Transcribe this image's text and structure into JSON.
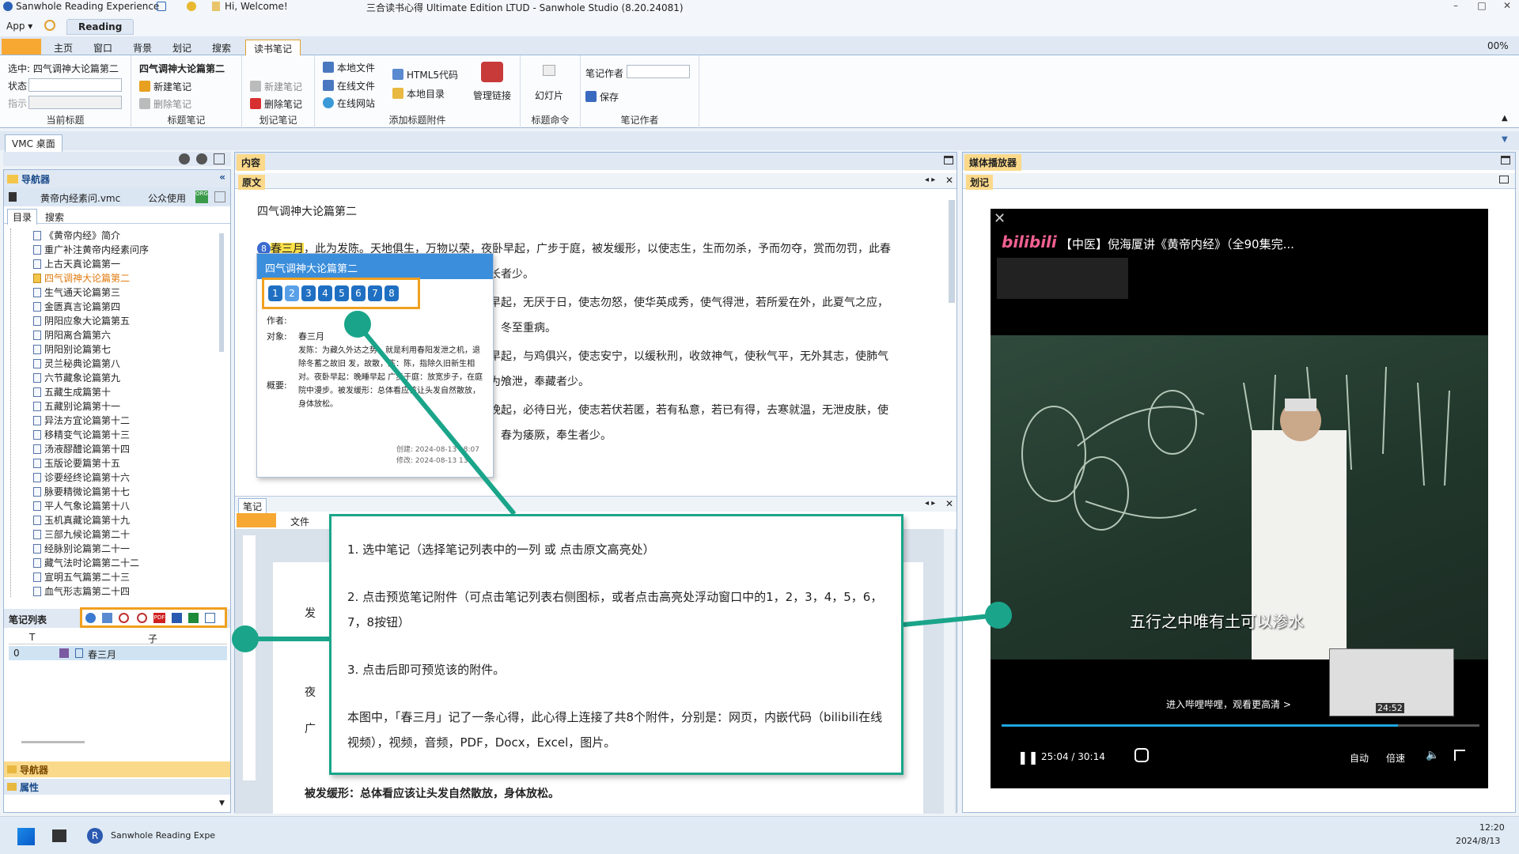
{
  "titlebar": {
    "app_name": "Sanwhole Reading Experience",
    "greeting": "Hi, Welcome!",
    "window_title": "三合读书心得 Ultimate Edition LTUD - Sanwhole Studio (8.20.24081)"
  },
  "menu": {
    "app": "App",
    "reading_tab": "Reading",
    "zoom": "00%"
  },
  "ribbon_tabs": [
    "主页",
    "窗口",
    "背景",
    "划记",
    "搜索",
    "读书笔记"
  ],
  "ribbon": {
    "selected_label": "选中: 四气调神大论篇第二",
    "status_label": "状态",
    "pointer_label": "指示",
    "group1": "当前标题",
    "title_name": "四气调神大论篇第二",
    "new_note": "新建笔记",
    "delete_note": "删除笔记",
    "group2": "标题笔记",
    "new_note2": "新建笔记",
    "delete_note2": "删除笔记",
    "group3": "划记笔记",
    "local_file": "本地文件",
    "online_file": "在线文件",
    "online_site": "在线网站",
    "html5": "HTML5代码",
    "local_dir": "本地目录",
    "group4": "添加标题附件",
    "manage_link": "管理链接",
    "slides": "幻灯片",
    "group5": "标题命令",
    "note_author": "笔记作者",
    "save": "保存",
    "group6": "笔记作者"
  },
  "vmc_tab": "VMC 桌面",
  "navigator": {
    "title": "导航器",
    "file": "黄帝内经素问.vmc",
    "public_use": "公众使用",
    "tabs": [
      "目录",
      "搜索"
    ],
    "tree": [
      "《黄帝内经》简介",
      "重广补注黄帝内经素问序",
      "上古天真论篇第一",
      "四气调神大论篇第二",
      "生气通天论篇第三",
      "金匮真言论篇第四",
      "阴阳应象大论篇第五",
      "阴阳离合篇第六",
      "阴阳别论篇第七",
      "灵兰秘典论篇第八",
      "六节藏象论篇第九",
      "五藏生成篇第十",
      "五藏别论篇第十一",
      "异法方宜论篇第十二",
      "移精变气论篇第十三",
      "汤液醪醴论篇第十四",
      "玉版论要篇第十五",
      "诊要经终论篇第十六",
      "脉要精微论篇第十七",
      "平人气象论篇第十八",
      "玉机真藏论篇第十九",
      "三部九候论篇第二十",
      "经脉别论篇第二十一",
      "藏气法时论篇第二十二",
      "宣明五气篇第二十三",
      "血气形志篇第二十四"
    ],
    "selected_index": 3,
    "note_list_title": "笔记列表",
    "col_t": "T",
    "col_title": "子",
    "row_index": "0",
    "row_title": "春三月",
    "bottom1": "导航器",
    "bottom2": "属性"
  },
  "content": {
    "panel_title": "内容",
    "tab_original": "原文",
    "heading": "四气调神大论篇第二",
    "badge": "8",
    "highlight": "春三月",
    "line1": "，此为发陈。天地俱生，万物以荣，夜卧早起，广步于庭，被发缓形，以使志生，生而勿杀，予而勿夺，赏而勿罚，此春",
    "line1b": "之应，养生之道也；逆之则伤肝，夏为寒变，奉长者少。",
    "line2": "夏三月，此谓蕃秀，天地气交，万物华实，夜卧早起，无厌于日，使志勿怒，使华英成秀，使气得泄，若所爱在外，此夏气之应，",
    "line2b": "养长之道也；逆之则伤心，秋为痎疟，奉收者少，冬至重病。",
    "line3": "秋三月，此谓容平，天气以急，地气以明，早卧早起，与鸡俱兴，使志安宁，以缓秋刑，收敛神气，使秋气平，无外其志，使肺气",
    "line3b": "清，此秋气之应，养收之道也；逆之则伤肺，冬为飧泄，奉藏者少。",
    "line4": "冬三月，此谓闭藏，水冰地坼，无扰乎阳，早卧晚起，必待日光，使志若伏若匿，若有私意，若已有得，去寒就温，无泄皮肤，使",
    "line4b": "气亟夺，此冬气之应，养藏之道也；逆之则伤肾，春为痿厥，奉生者少。",
    "note_tab": "笔记",
    "note_file": "文件",
    "doc_lines": [
      "发",
      "夜",
      "广",
      "被发缓形：总体看应该让头发自然散放，身体放松。"
    ]
  },
  "popup": {
    "title": "四气调神大论篇第二",
    "buttons": [
      "1",
      "2",
      "3",
      "4",
      "5",
      "6",
      "7",
      "8"
    ],
    "author_label": "作者:",
    "object_label": "对象:",
    "object_value": "春三月",
    "summary_label": "概要:",
    "summary": "发陈：为藏久外达之势，就是利用春阳发泄之机，退除冬蓄之故旧 发，故散，陈：陈，指除久旧新生相对。夜卧早起：晚睡早起 广步于庭：放宽步子，在庭院中漫步。被发缓形：总体看应该让头发自然散放，身体放松。",
    "created": "创建: 2024-08-13 18:07",
    "modified": "修改: 2024-08-13 13"
  },
  "callout": {
    "p1": "1. 选中笔记（选择笔记列表中的一列 或 点击原文高亮处）",
    "p2": "2. 点击预览笔记附件（可点击笔记列表右侧图标，或者点击高亮处浮动窗口中的1，2，3，4，5，6，7，8按钮）",
    "p3": "3. 点击后即可预览该的附件。",
    "p4": "本图中，「春三月」记了一条心得，此心得上连接了共8个附件，分别是：网页，内嵌代码（bilibili在线视频），视频，音频，PDF，Docx，Excel，图片。"
  },
  "media": {
    "panel_title": "媒体播放器",
    "tab": "划记",
    "logo": "bilibili",
    "video_title": "【中医】倪海厦讲《黄帝内经》（全90集完...",
    "subtitle": "五行之中唯有土可以渗水",
    "promo": "进入哔哩哔哩，观看更高清 >",
    "thumb_time": "24:52",
    "time": "25:04 / 30:14",
    "auto": "自动",
    "speed": "倍速",
    "progress": 0.83
  },
  "taskbar": {
    "app": "Sanwhole Reading Expe",
    "time": "12:20",
    "date": "2024/8/13"
  }
}
